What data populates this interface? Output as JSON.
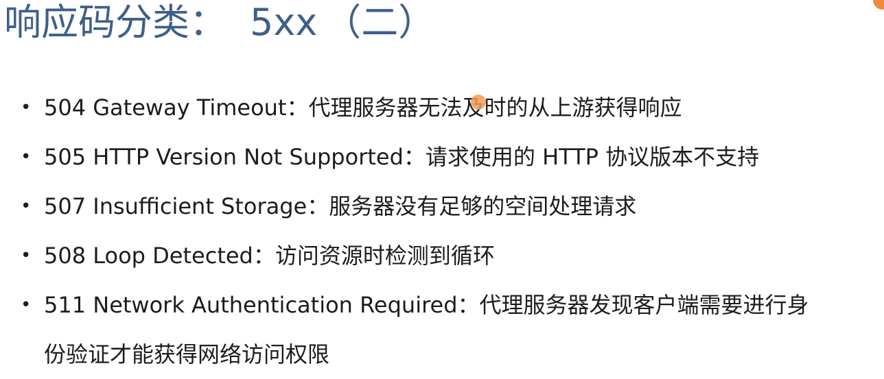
{
  "title": {
    "main": "响应码分类：",
    "code": "5xx",
    "part": "（二）"
  },
  "items": [
    {
      "code": "504 Gateway Timeout",
      "sep": "：",
      "desc": "代理服务器无法及时的从上游获得响应"
    },
    {
      "code": "505 HTTP Version Not Supported",
      "sep": "：",
      "desc": "请求使用的 HTTP 协议版本不支持"
    },
    {
      "code": "507 Insufficient Storage",
      "sep": "：",
      "desc": "服务器没有足够的空间处理请求"
    },
    {
      "code": "508 Loop Detected",
      "sep": "：",
      "desc": "访问资源时检测到循环"
    },
    {
      "code": "511 Network Authentication Required",
      "sep": "：",
      "desc": "代理服务器发现客户端需要进行身份验证才能获得网络访问权限"
    }
  ],
  "bullet_symbol": "•",
  "colors": {
    "title": "#3f5f8a",
    "text": "#1c1c1c",
    "accent_dot": "#f08a3c"
  }
}
